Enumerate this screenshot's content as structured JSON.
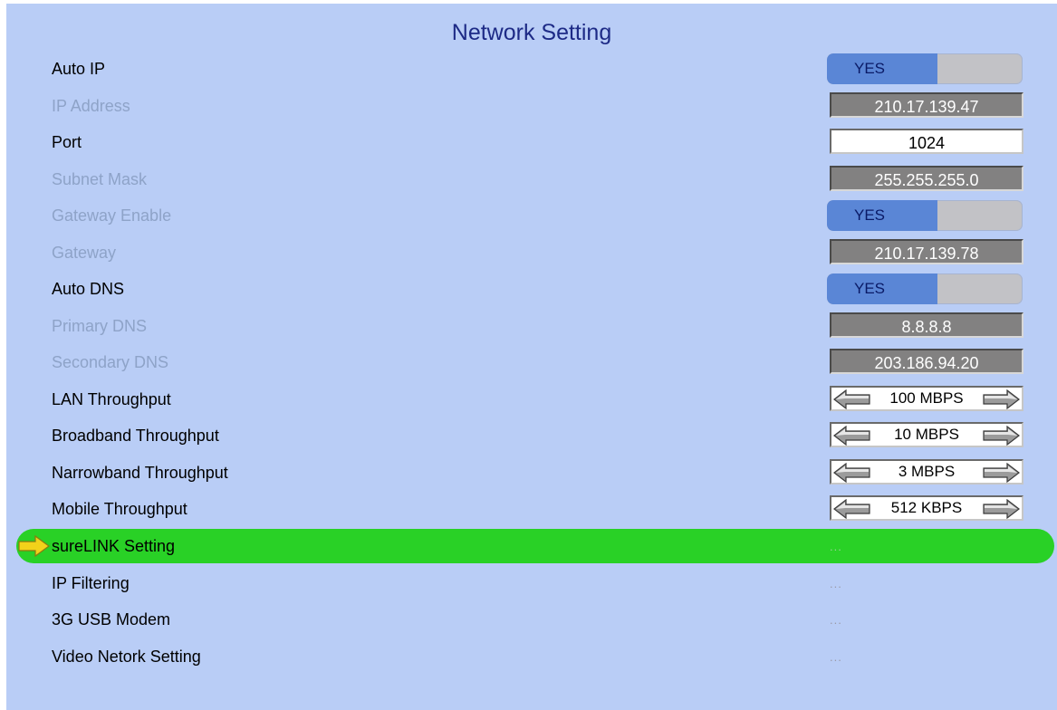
{
  "title": "Network Setting",
  "rows": [
    {
      "label": "Auto IP",
      "type": "toggle",
      "value": "YES",
      "enabled": true
    },
    {
      "label": "IP Address",
      "type": "value-grey",
      "value": "210.17.139.47",
      "enabled": false
    },
    {
      "label": "Port",
      "type": "value-white",
      "value": "1024",
      "enabled": true
    },
    {
      "label": "Subnet Mask",
      "type": "value-grey",
      "value": "255.255.255.0",
      "enabled": false
    },
    {
      "label": "Gateway Enable",
      "type": "toggle",
      "value": "YES",
      "enabled": false
    },
    {
      "label": "Gateway",
      "type": "value-grey",
      "value": "210.17.139.78",
      "enabled": false
    },
    {
      "label": "Auto DNS",
      "type": "toggle",
      "value": "YES",
      "enabled": true
    },
    {
      "label": "Primary DNS",
      "type": "value-grey",
      "value": "8.8.8.8",
      "enabled": false
    },
    {
      "label": "Secondary DNS",
      "type": "value-grey",
      "value": "203.186.94.20",
      "enabled": false
    },
    {
      "label": "LAN Throughput",
      "type": "spinner",
      "value": "100 MBPS",
      "enabled": true
    },
    {
      "label": "Broadband Throughput",
      "type": "spinner",
      "value": "10 MBPS",
      "enabled": true
    },
    {
      "label": "Narrowband Throughput",
      "type": "spinner",
      "value": "3 MBPS",
      "enabled": true
    },
    {
      "label": "Mobile Throughput",
      "type": "spinner",
      "value": "512 KBPS",
      "enabled": true
    },
    {
      "label": "sureLINK Setting",
      "type": "submenu",
      "value": "...",
      "enabled": true,
      "selected": true
    },
    {
      "label": "IP Filtering",
      "type": "submenu",
      "value": "...",
      "enabled": true
    },
    {
      "label": "3G USB Modem",
      "type": "submenu",
      "value": "...",
      "enabled": true
    },
    {
      "label": "Video Netork Setting",
      "type": "submenu",
      "value": "...",
      "enabled": true
    }
  ],
  "colors": {
    "background": "#b9cdf6",
    "title": "#1d2a86",
    "toggle_on": "#5a86d6",
    "value_box_disabled": "#828181",
    "selected_row": "#29d126",
    "pointer": "#f2d21a"
  }
}
